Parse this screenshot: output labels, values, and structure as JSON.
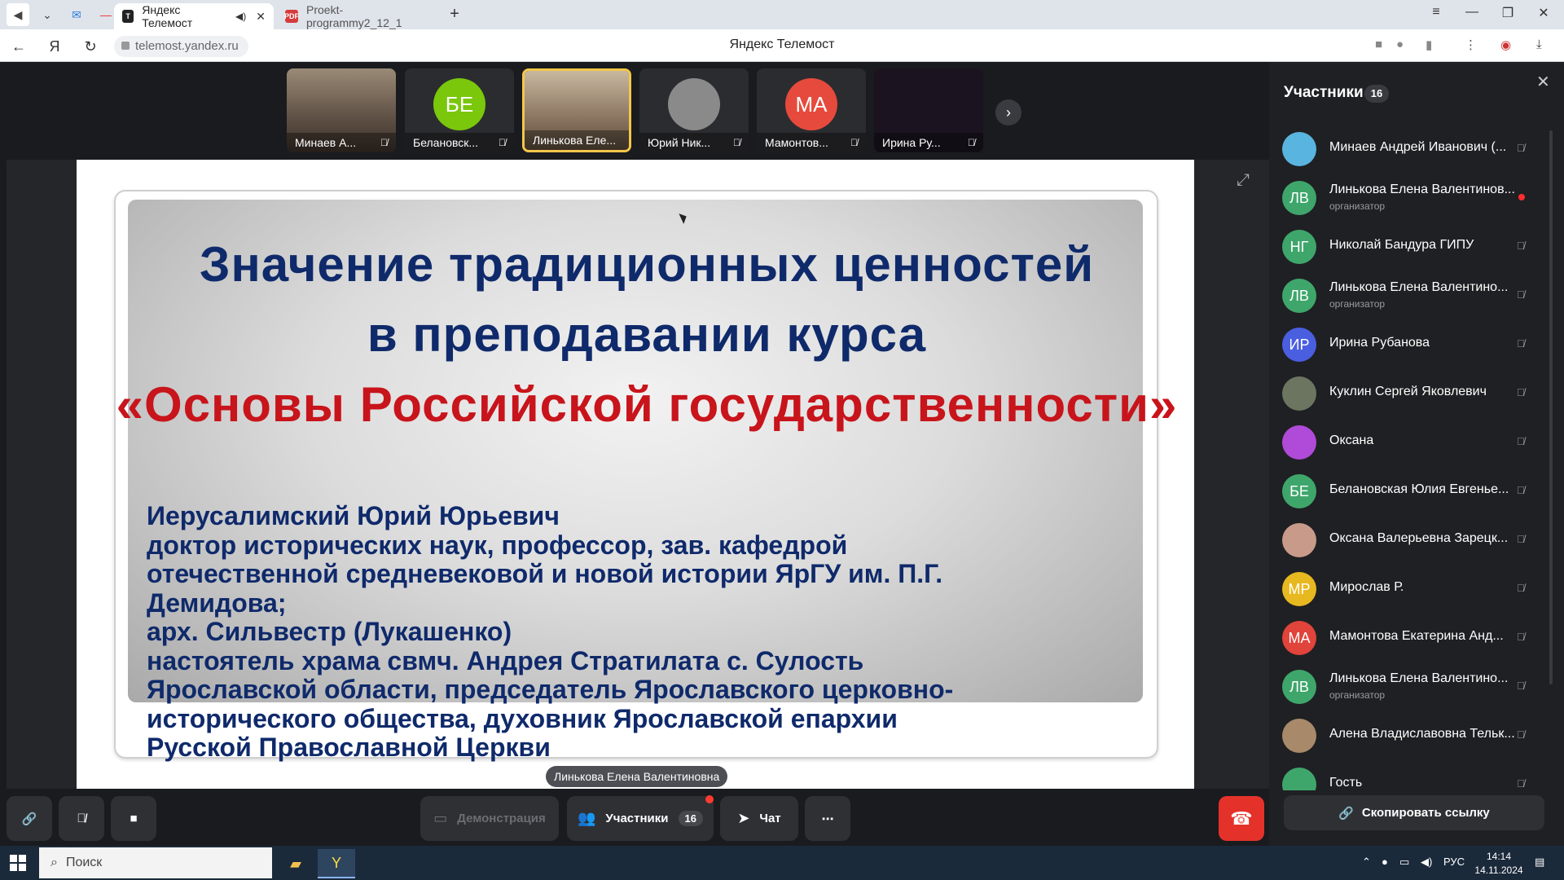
{
  "browser": {
    "tabs": [
      {
        "label": "Яндекс Телемост",
        "active": true
      },
      {
        "label": "Proekt-programmy2_12_1",
        "active": false
      }
    ],
    "url": "telemost.yandex.ru",
    "page_title": "Яндекс Телемост"
  },
  "stage": {
    "thumbnails": [
      {
        "name": "Минаев А...",
        "initials": "",
        "color": "#6b5a4a",
        "active": false
      },
      {
        "name": "Белановск...",
        "initials": "БЕ",
        "color": "#7ac70c",
        "active": false
      },
      {
        "name": "Линькова Еле...",
        "initials": "",
        "color": "#8a7a6a",
        "active": true
      },
      {
        "name": "Юрий Ник...",
        "initials": "",
        "color": "#7a7a7a",
        "active": false
      },
      {
        "name": "Мамонтов...",
        "initials": "МА",
        "color": "#e64a3c",
        "active": false
      },
      {
        "name": "Ирина Ру...",
        "initials": "",
        "color": "#1b1420",
        "active": false
      }
    ],
    "speaker_label": "Линькова Елена Валентиновна",
    "slide": {
      "title_line1": "Значение традиционных ценностей",
      "title_line2": "в преподавании курса",
      "title_line3": "«Основы Российской государственности»",
      "body_lines": [
        "Иерусалимский Юрий Юрьевич",
        "доктор исторических наук, профессор, зав. кафедрой",
        "отечественной средневековой и новой истории ЯрГУ им. П.Г.",
        "Демидова;",
        "арх. Сильвестр (Лукашенко)",
        "настоятель храма свмч. Андрея Стратилата с. Сулость",
        "Ярославской области, председатель Ярославского церковно-",
        "исторического общества, духовник Ярославской епархии",
        "Русской Православной Церкви"
      ]
    }
  },
  "toolbar": {
    "demo_label": "Демонстрация",
    "participants_label": "Участники",
    "participants_count": "16",
    "chat_label": "Чат"
  },
  "panel": {
    "title": "Участники",
    "count": "16",
    "copy_link_label": "Скопировать ссылку",
    "organizer_role": "организатор",
    "participants": [
      {
        "name": "Минаев Андрей Иванович (...",
        "initials": "",
        "color": "#5ab4e0",
        "role": ""
      },
      {
        "name": "Линькова Елена Валентинов...",
        "initials": "ЛВ",
        "color": "#3fa66b",
        "role": "организатор",
        "recording": true
      },
      {
        "name": "Николай Бандура ГИПУ",
        "initials": "НГ",
        "color": "#3fa66b",
        "role": ""
      },
      {
        "name": "Линькова Елена Валентино...",
        "initials": "ЛВ",
        "color": "#3fa66b",
        "role": "организатор"
      },
      {
        "name": "Ирина Рубанова",
        "initials": "ИР",
        "color": "#4a5ee0",
        "role": ""
      },
      {
        "name": "Куклин Сергей Яковлевич",
        "initials": "",
        "color": "#6b7560",
        "role": ""
      },
      {
        "name": "Оксана",
        "initials": "",
        "color": "#b04ad8",
        "role": ""
      },
      {
        "name": "Белановская Юлия Евгенье...",
        "initials": "БЕ",
        "color": "#3fa66b",
        "role": ""
      },
      {
        "name": "Оксана Валерьевна Зарецк...",
        "initials": "",
        "color": "#c89a8a",
        "role": ""
      },
      {
        "name": "Мирослав Р.",
        "initials": "МР",
        "color": "#e8b820",
        "role": ""
      },
      {
        "name": "Мамонтова Екатерина Анд...",
        "initials": "МА",
        "color": "#e0443a",
        "role": ""
      },
      {
        "name": "Линькова Елена Валентино...",
        "initials": "ЛВ",
        "color": "#3fa66b",
        "role": "организатор"
      },
      {
        "name": "Алена Владиславовна Тельк...",
        "initials": "",
        "color": "#a88a6a",
        "role": ""
      },
      {
        "name": "Гость",
        "initials": "",
        "color": "#3fa66b",
        "role": ""
      }
    ]
  },
  "taskbar": {
    "search_placeholder": "Поиск",
    "lang": "РУС",
    "time": "14:14",
    "date": "14.11.2024"
  }
}
